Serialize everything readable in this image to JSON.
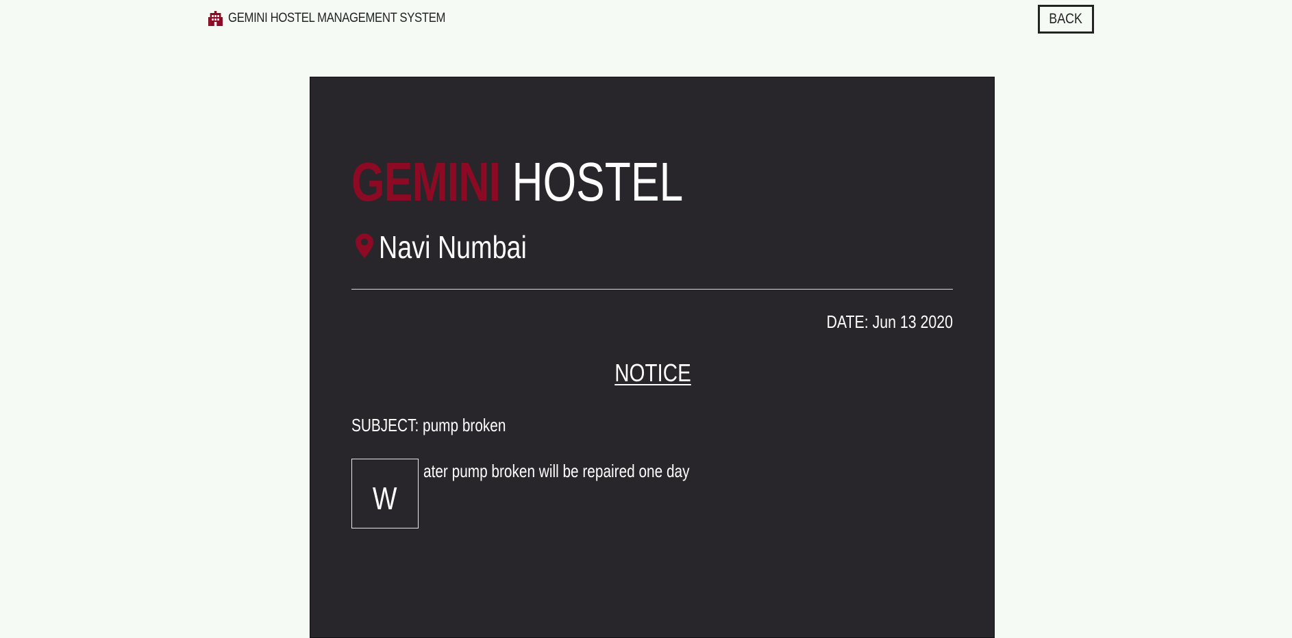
{
  "navbar": {
    "brand_icon": "building-icon",
    "brand_label": "GEMINI HOSTEL MANAGEMENT SYSTEM",
    "back_label": "BACK"
  },
  "notice": {
    "title_accent": "GEMINI",
    "title_rest": "HOSTEL",
    "location_icon": "map-pin-icon",
    "location": "Navi Numbai",
    "date": "DATE: Jun 13 2020",
    "heading": "NOTICE",
    "subject": "SUBJECT: pump broken",
    "body_first_letter": "W",
    "body_rest": "ater pump broken will be repaired one day"
  },
  "colors": {
    "page_background": "#f5faf5",
    "card_background": "#28262a",
    "accent": "#8c0a24",
    "text_light": "#ffffff",
    "text_dark": "#222222"
  }
}
